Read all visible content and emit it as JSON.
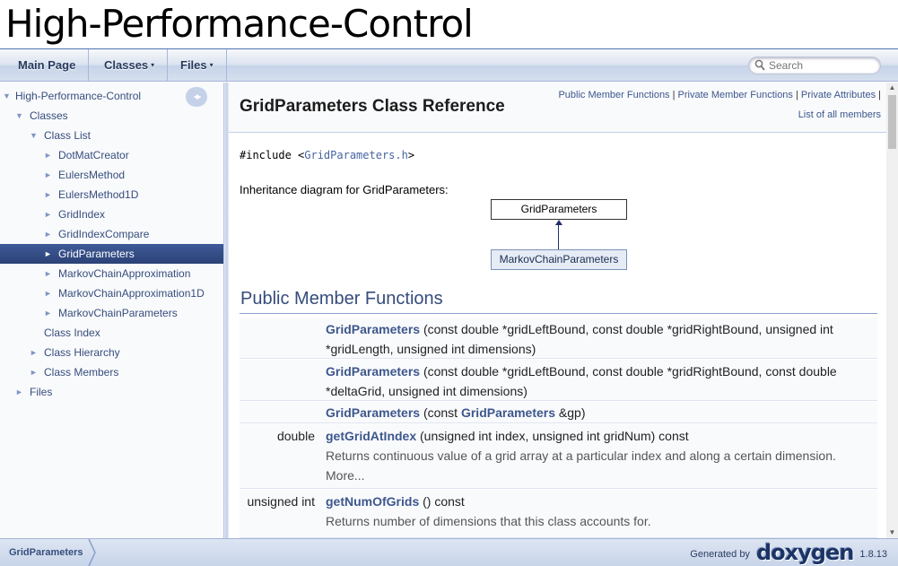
{
  "project_name": "High-Performance-Control",
  "navbar": {
    "tabs": [
      {
        "label": "Main Page"
      },
      {
        "label": "Classes",
        "caret": "▾"
      },
      {
        "label": "Files",
        "caret": "▾"
      }
    ],
    "search_placeholder": "Search"
  },
  "sidenav": {
    "sync_button": "◂▸",
    "items": [
      {
        "label": "High-Performance-Control",
        "arrow": "▼"
      },
      {
        "label": "Classes",
        "arrow": "▼"
      },
      {
        "label": "Class List",
        "arrow": "▼"
      },
      {
        "label": "DotMatCreator",
        "arrow": "►"
      },
      {
        "label": "EulersMethod",
        "arrow": "►"
      },
      {
        "label": "EulersMethod1D",
        "arrow": "►"
      },
      {
        "label": "GridIndex",
        "arrow": "►"
      },
      {
        "label": "GridIndexCompare",
        "arrow": "►"
      },
      {
        "label": "GridParameters",
        "arrow": "►",
        "selected": true
      },
      {
        "label": "MarkovChainApproximation",
        "arrow": "►"
      },
      {
        "label": "MarkovChainApproximation1D",
        "arrow": "►"
      },
      {
        "label": "MarkovChainParameters",
        "arrow": "►"
      },
      {
        "label": "Class Index",
        "arrow": ""
      },
      {
        "label": "Class Hierarchy",
        "arrow": "►"
      },
      {
        "label": "Class Members",
        "arrow": "►"
      },
      {
        "label": "Files",
        "arrow": "►"
      }
    ]
  },
  "content": {
    "summary_links": {
      "public_member_functions": "Public Member Functions",
      "private_member_functions": "Private Member Functions",
      "private_attributes": "Private Attributes",
      "sep": "|",
      "list_all_members": "List of all members"
    },
    "title": "GridParameters Class Reference",
    "include_prefix": "#include <",
    "include_file": "GridParameters.h",
    "include_suffix": ">",
    "inheritance_label": "Inheritance diagram for GridParameters:",
    "diagram": {
      "base": "GridParameters",
      "derived": "MarkovChainParameters"
    },
    "section_title": "Public Member Functions",
    "members": [
      {
        "rettype": "",
        "name": "GridParameters",
        "args": " (const double *gridLeftBound, const double *gridRightBound, unsigned int *gridLength, unsigned int dimensions)",
        "desc": "",
        "more": ""
      },
      {
        "rettype": "",
        "name": "GridParameters",
        "args": " (const double *gridLeftBound, const double *gridRightBound, const double *deltaGrid, unsigned int dimensions)",
        "desc": "",
        "more": ""
      },
      {
        "rettype": "",
        "name": "GridParameters",
        "args_pre": " (const ",
        "args_link": "GridParameters",
        "args_post": " &gp)",
        "desc": "",
        "more": ""
      },
      {
        "rettype": "double",
        "name": "getGridAtIndex",
        "args": " (unsigned int index, unsigned int gridNum) const",
        "desc": "Returns continuous value of a grid array at a particular index and along a certain dimension.",
        "more": "More..."
      },
      {
        "rettype": "unsigned int",
        "name": "getNumOfGrids",
        "args": " () const",
        "desc": "Returns number of dimensions that this class accounts for.",
        "more": ""
      }
    ]
  },
  "footer": {
    "breadcrumb": "GridParameters",
    "generated_by": "Generated by",
    "logo": "doxygen",
    "version": "1.8.13"
  },
  "colors": {
    "link": "#3D578C",
    "nav_selected": "#2c4277",
    "section_title": "#354C7B"
  }
}
